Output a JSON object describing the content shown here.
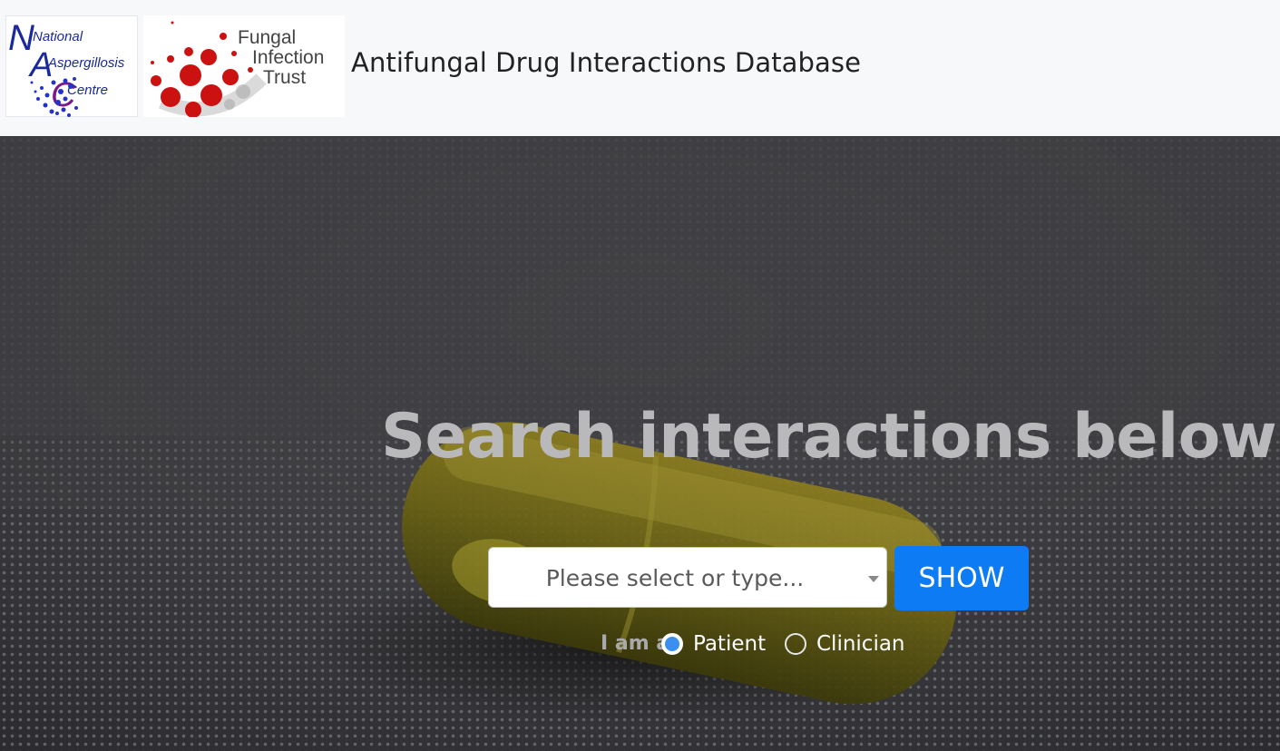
{
  "header": {
    "nac_logo": {
      "line1": "National",
      "line2": "Aspergillosis",
      "line3": "Centre"
    },
    "fit_logo": {
      "line1": "Fungal",
      "line2": "Infection",
      "line3": "Trust"
    },
    "title": "Antifungal Drug Interactions Database"
  },
  "hero": {
    "heading": "Search interactions below",
    "select_placeholder": "Please select or type...",
    "show_button": "SHOW",
    "role_label": "I am a",
    "roles": [
      {
        "label": "Patient",
        "selected": true
      },
      {
        "label": "Clinician",
        "selected": false
      }
    ]
  },
  "colors": {
    "navbar_bg": "#f7f8fa",
    "button_blue": "#0d7bf4",
    "heading_gray": "#b9b9bb",
    "radio_selected": "#3a8ff0"
  }
}
